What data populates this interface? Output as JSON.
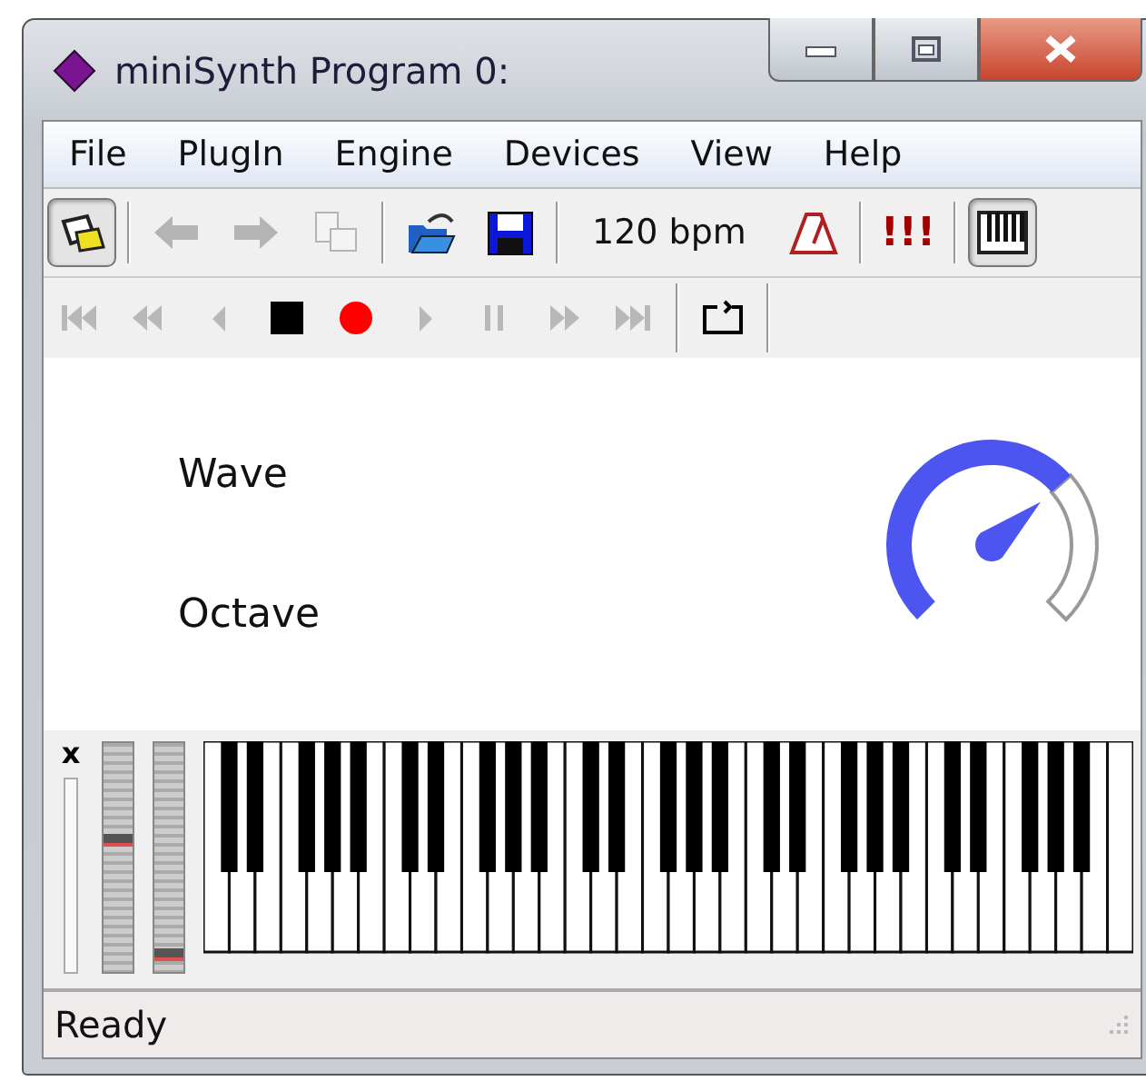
{
  "window": {
    "title": "miniSynth Program 0:"
  },
  "menu": [
    "File",
    "PlugIn",
    "Engine",
    "Devices",
    "View",
    "Help"
  ],
  "toolbar": [
    {
      "kind": "plugin",
      "pressed": true
    },
    {
      "kind": "separator"
    },
    {
      "kind": "back",
      "disabled": true
    },
    {
      "kind": "forward",
      "disabled": true
    },
    {
      "kind": "copy",
      "disabled": true
    },
    {
      "kind": "separator"
    },
    {
      "kind": "open"
    },
    {
      "kind": "save"
    },
    {
      "kind": "separator"
    },
    {
      "kind": "tempo",
      "text": "120 bpm"
    },
    {
      "kind": "metronome"
    },
    {
      "kind": "separator"
    },
    {
      "kind": "panic",
      "text": "!!!"
    },
    {
      "kind": "separator"
    },
    {
      "kind": "keyboard",
      "pressed": true
    }
  ],
  "transport": [
    {
      "kind": "first",
      "disabled": true
    },
    {
      "kind": "rewind",
      "disabled": true
    },
    {
      "kind": "back",
      "disabled": true
    },
    {
      "kind": "stop",
      "disabled": false
    },
    {
      "kind": "record",
      "disabled": false
    },
    {
      "kind": "play",
      "disabled": true
    },
    {
      "kind": "pause",
      "disabled": true
    },
    {
      "kind": "forward",
      "disabled": true
    },
    {
      "kind": "last",
      "disabled": true
    },
    {
      "kind": "separator"
    },
    {
      "kind": "loop",
      "disabled": false
    },
    {
      "kind": "separator"
    }
  ],
  "parameters": [
    {
      "label": "Wave"
    },
    {
      "label": "Octave"
    }
  ],
  "knob": {
    "level": 0.68
  },
  "keyboard_panel": {
    "close_mark": "x",
    "sliders": [
      {
        "level": 0.55
      },
      {
        "level": 0.05
      }
    ]
  },
  "status_bar": {
    "text": "Ready"
  }
}
